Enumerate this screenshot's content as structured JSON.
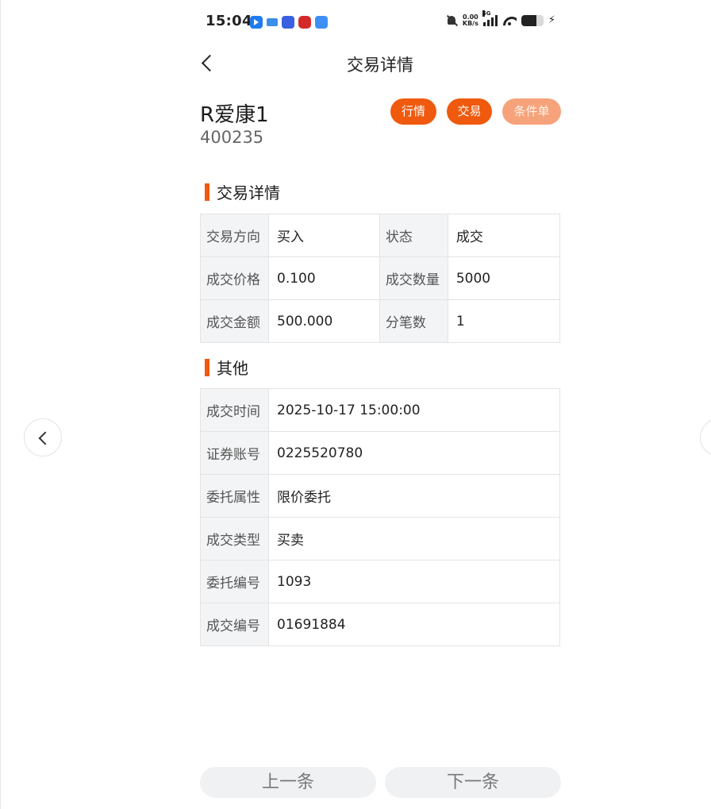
{
  "status_bar": {
    "time": "15:04",
    "net_speed_value": "0.00",
    "net_speed_unit": "KB/s",
    "network": "5G",
    "battery_percent": 70
  },
  "header": {
    "title": "交易详情"
  },
  "stock": {
    "name": "R爱康1",
    "code": "400235",
    "tags": [
      "行情",
      "交易",
      "条件单"
    ]
  },
  "trade_details": {
    "section_title": "交易详情",
    "rows": [
      [
        {
          "label": "交易方向",
          "value": "买入"
        },
        {
          "label": "状态",
          "value": "成交"
        }
      ],
      [
        {
          "label": "成交价格",
          "value": "0.100"
        },
        {
          "label": "成交数量",
          "value": "5000"
        }
      ],
      [
        {
          "label": "成交金额",
          "value": "500.000"
        },
        {
          "label": "分笔数",
          "value": "1"
        }
      ]
    ]
  },
  "other": {
    "section_title": "其他",
    "rows": [
      {
        "label": "成交时间",
        "value": "2025-10-17 15:00:00"
      },
      {
        "label": "证券账号",
        "value": "0225520780"
      },
      {
        "label": "委托属性",
        "value": "限价委托"
      },
      {
        "label": "成交类型",
        "value": "买卖"
      },
      {
        "label": "委托编号",
        "value": "1093"
      },
      {
        "label": "成交编号",
        "value": "01691884"
      }
    ]
  },
  "footer": {
    "prev_label": "上一条",
    "next_label": "下一条"
  },
  "colors": {
    "accent": "#f05a0e",
    "accent_disabled": "#f6a27a",
    "label_bg": "#f3f4f6"
  }
}
